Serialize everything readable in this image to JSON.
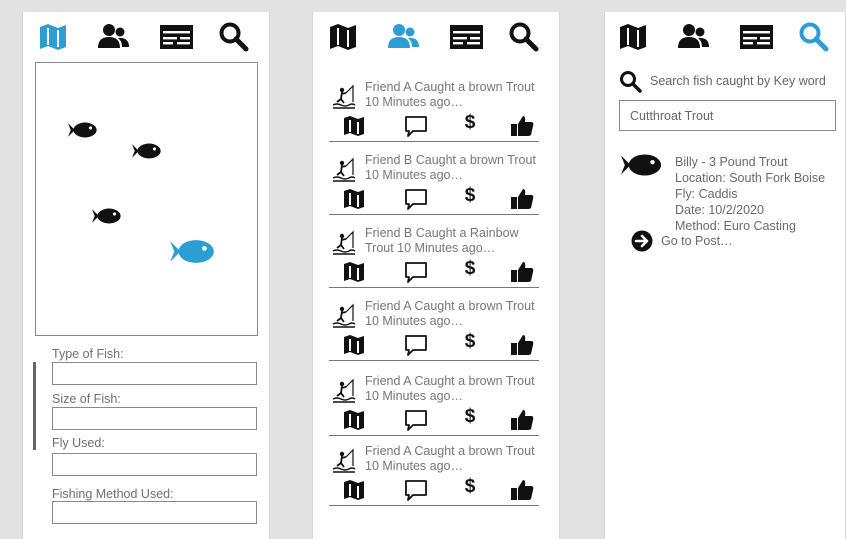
{
  "colors": {
    "accent": "#2c9ed3",
    "icon": "#111111",
    "text": "#6b6b6b"
  },
  "nav_icons": [
    "map-icon",
    "friends-icon",
    "feed-icon",
    "search-icon"
  ],
  "screens": [
    {
      "name": "map",
      "active_tab": "map"
    },
    {
      "name": "feed",
      "active_tab": "friends"
    },
    {
      "name": "search",
      "active_tab": "search"
    }
  ],
  "map_form": {
    "type_label": "Type of Fish:",
    "size_label": "Size of Fish:",
    "fly_label": "Fly Used:",
    "method_label": "Fishing Method Used:"
  },
  "feed": {
    "posts": [
      {
        "text": "Friend A Caught a brown Trout 10 Minutes ago…"
      },
      {
        "text": "Friend B Caught a brown Trout 10 Minutes ago…"
      },
      {
        "text": "Friend B Caught a Rainbow Trout 10 Minutes ago…"
      },
      {
        "text": "Friend A Caught a brown Trout 10 Minutes ago…"
      },
      {
        "text": "Friend A Caught a brown Trout 10 Minutes ago…"
      },
      {
        "text": "Friend A Caught a brown Trout 10 Minutes ago…"
      }
    ],
    "dollar_symbol": "$"
  },
  "search": {
    "prompt": "Search fish caught by Key word",
    "query": "Cutthroat Trout",
    "result": {
      "title": "Billy - 3 Pound Trout",
      "location": "Location: South Fork Boise",
      "fly": "Fly: Caddis",
      "date": "Date: 10/2/2020",
      "method": "Method: Euro Casting",
      "goto_label": "Go to Post…"
    }
  }
}
